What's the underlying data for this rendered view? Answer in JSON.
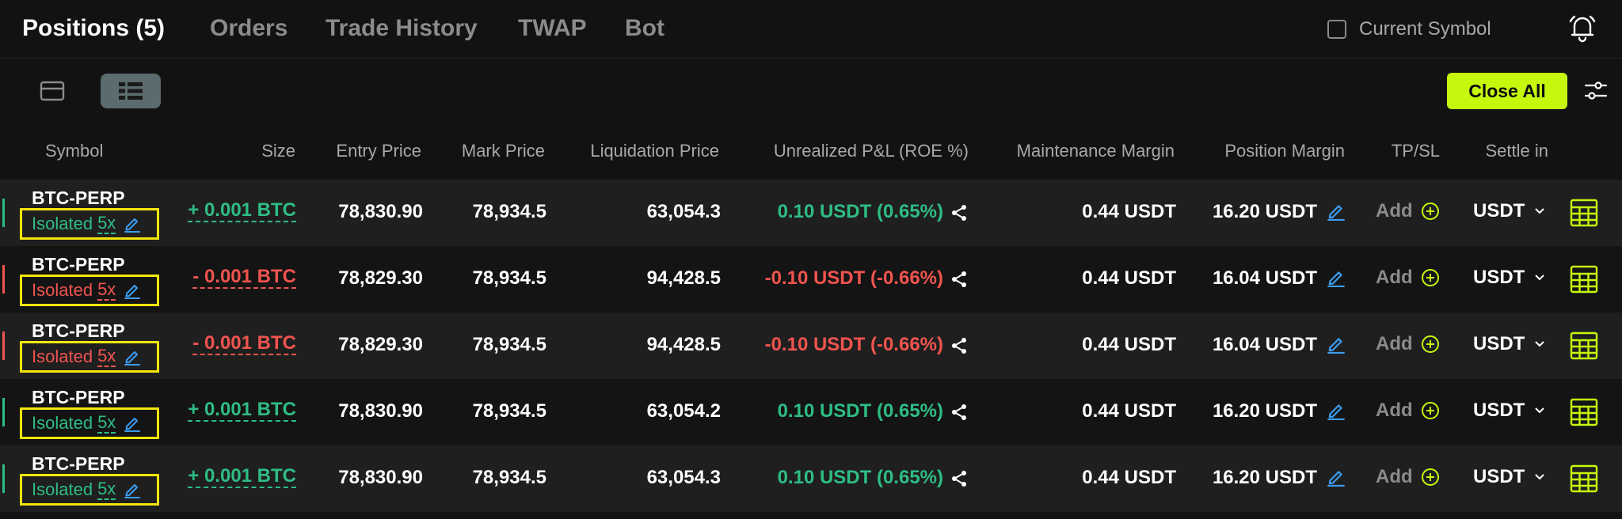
{
  "tabs": [
    {
      "label": "Positions (5)",
      "active": true
    },
    {
      "label": "Orders",
      "active": false
    },
    {
      "label": "Trade History",
      "active": false
    },
    {
      "label": "TWAP",
      "active": false
    },
    {
      "label": "Bot",
      "active": false
    }
  ],
  "current_symbol": {
    "label": "Current Symbol",
    "checked": false
  },
  "toolbar": {
    "close_all_label": "Close All",
    "view_modes": [
      "card-view-icon",
      "list-view-icon"
    ],
    "active_view": "list-view-icon"
  },
  "columns": [
    "Symbol",
    "Size",
    "Entry Price",
    "Mark Price",
    "Liquidation Price",
    "Unrealized P&L (ROE %)",
    "Maintenance Margin",
    "Position Margin",
    "TP/SL",
    "Settle in"
  ],
  "colors": {
    "accent": "#c6f80e",
    "profit": "#2ebd85",
    "loss": "#f0544f",
    "link": "#3b9cf0",
    "highlight_box": "#f5e60a"
  },
  "positions": [
    {
      "symbol": "BTC-PERP",
      "mode": "Isolated",
      "leverage": "5x",
      "side": "long",
      "size": "+ 0.001 BTC",
      "entry_price": "78,830.90",
      "mark_price": "78,934.5",
      "liquidation_price": "63,054.3",
      "pnl": "0.10 USDT (0.65%)",
      "maintenance_margin": "0.44 USDT",
      "position_margin": "16.20 USDT",
      "tpsl": "Add",
      "settle": "USDT"
    },
    {
      "symbol": "BTC-PERP",
      "mode": "Isolated",
      "leverage": "5x",
      "side": "short",
      "size": "- 0.001 BTC",
      "entry_price": "78,829.30",
      "mark_price": "78,934.5",
      "liquidation_price": "94,428.5",
      "pnl": "-0.10 USDT (-0.66%)",
      "maintenance_margin": "0.44 USDT",
      "position_margin": "16.04 USDT",
      "tpsl": "Add",
      "settle": "USDT"
    },
    {
      "symbol": "BTC-PERP",
      "mode": "Isolated",
      "leverage": "5x",
      "side": "short",
      "size": "- 0.001 BTC",
      "entry_price": "78,829.30",
      "mark_price": "78,934.5",
      "liquidation_price": "94,428.5",
      "pnl": "-0.10 USDT (-0.66%)",
      "maintenance_margin": "0.44 USDT",
      "position_margin": "16.04 USDT",
      "tpsl": "Add",
      "settle": "USDT"
    },
    {
      "symbol": "BTC-PERP",
      "mode": "Isolated",
      "leverage": "5x",
      "side": "long",
      "size": "+ 0.001 BTC",
      "entry_price": "78,830.90",
      "mark_price": "78,934.5",
      "liquidation_price": "63,054.2",
      "pnl": "0.10 USDT (0.65%)",
      "maintenance_margin": "0.44 USDT",
      "position_margin": "16.20 USDT",
      "tpsl": "Add",
      "settle": "USDT"
    },
    {
      "symbol": "BTC-PERP",
      "mode": "Isolated",
      "leverage": "5x",
      "side": "long",
      "size": "+ 0.001 BTC",
      "entry_price": "78,830.90",
      "mark_price": "78,934.5",
      "liquidation_price": "63,054.3",
      "pnl": "0.10 USDT (0.65%)",
      "maintenance_margin": "0.44 USDT",
      "position_margin": "16.20 USDT",
      "tpsl": "Add",
      "settle": "USDT"
    }
  ]
}
